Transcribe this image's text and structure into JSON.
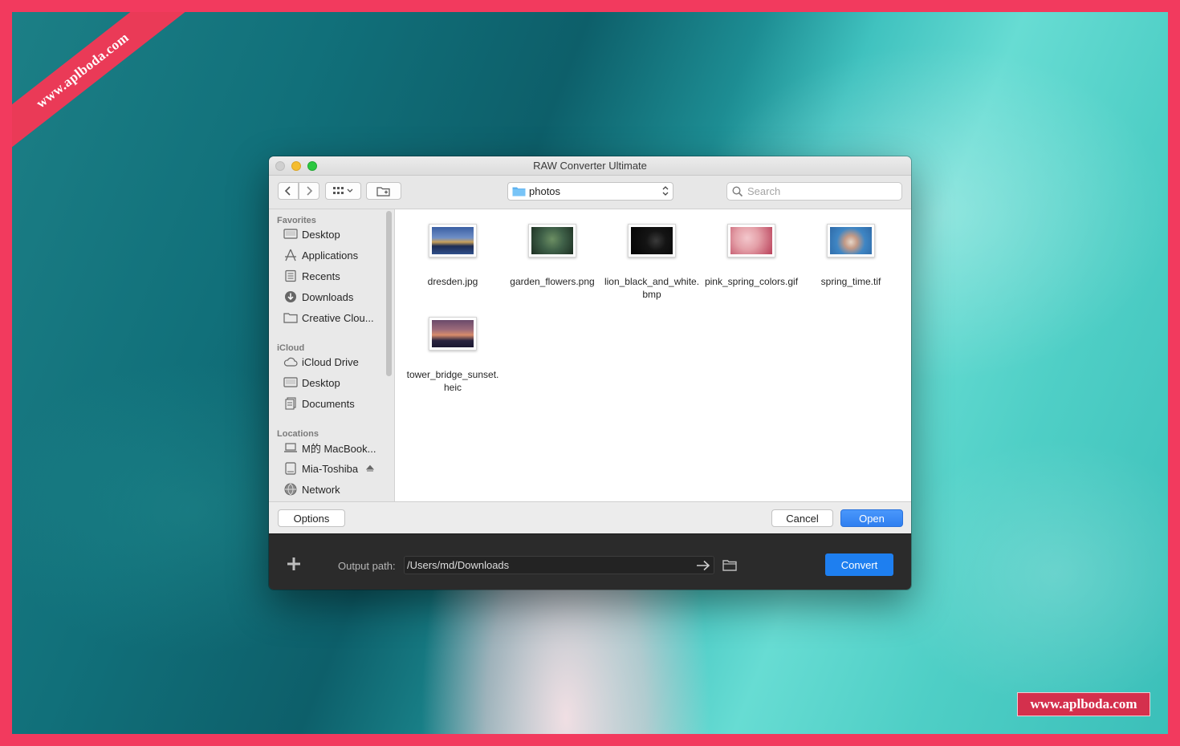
{
  "watermark": {
    "ribbon_text": "www.aplboda.com",
    "corner_text": "www.aplboda.com"
  },
  "window": {
    "title": "RAW Converter Ultimate"
  },
  "toolbar": {
    "location": "photos",
    "search_placeholder": "Search"
  },
  "sidebar": {
    "sections": [
      {
        "heading": "Favorites",
        "items": [
          {
            "label": "Desktop",
            "icon": "desktop-icon"
          },
          {
            "label": "Applications",
            "icon": "applications-icon"
          },
          {
            "label": "Recents",
            "icon": "recents-icon"
          },
          {
            "label": "Downloads",
            "icon": "downloads-icon"
          },
          {
            "label": "Creative Clou...",
            "icon": "folder-icon"
          }
        ]
      },
      {
        "heading": "iCloud",
        "items": [
          {
            "label": "iCloud Drive",
            "icon": "cloud-icon"
          },
          {
            "label": "Desktop",
            "icon": "desktop-icon"
          },
          {
            "label": "Documents",
            "icon": "documents-icon"
          }
        ]
      },
      {
        "heading": "Locations",
        "items": [
          {
            "label": "M的 MacBook...",
            "icon": "laptop-icon"
          },
          {
            "label": "Mia-Toshiba",
            "icon": "drive-icon"
          },
          {
            "label": "Network",
            "icon": "network-icon"
          }
        ]
      }
    ]
  },
  "files": [
    {
      "name": "dresden.jpg",
      "colors": [
        "#2f4f8a",
        "#c9a05a",
        "#1d2d55"
      ]
    },
    {
      "name": "garden_flowers.png",
      "colors": [
        "#2e4a36",
        "#6c8f63",
        "#1d2f22"
      ]
    },
    {
      "name": "lion_black_and_white.bmp",
      "colors": [
        "#0a0a0a",
        "#3a3a3a",
        "#050505"
      ]
    },
    {
      "name": "pink_spring_colors.gif",
      "colors": [
        "#e4a0a8",
        "#b9405a",
        "#f3c7cc"
      ]
    },
    {
      "name": "spring_time.tif",
      "colors": [
        "#3f86c4",
        "#e6d6c8",
        "#2e6aa8"
      ]
    },
    {
      "name": "tower_bridge_sunset.heic",
      "colors": [
        "#6a4a6a",
        "#d88c6a",
        "#2a2440"
      ]
    }
  ],
  "footer": {
    "options_label": "Options",
    "cancel_label": "Cancel",
    "open_label": "Open"
  },
  "app": {
    "output_label": "Output path:",
    "output_path": "/Users/md/Downloads",
    "convert_label": "Convert"
  },
  "colors": {
    "accent": "#2f7ff0",
    "convert": "#1e7ff0",
    "frame": "#f23a5e"
  }
}
